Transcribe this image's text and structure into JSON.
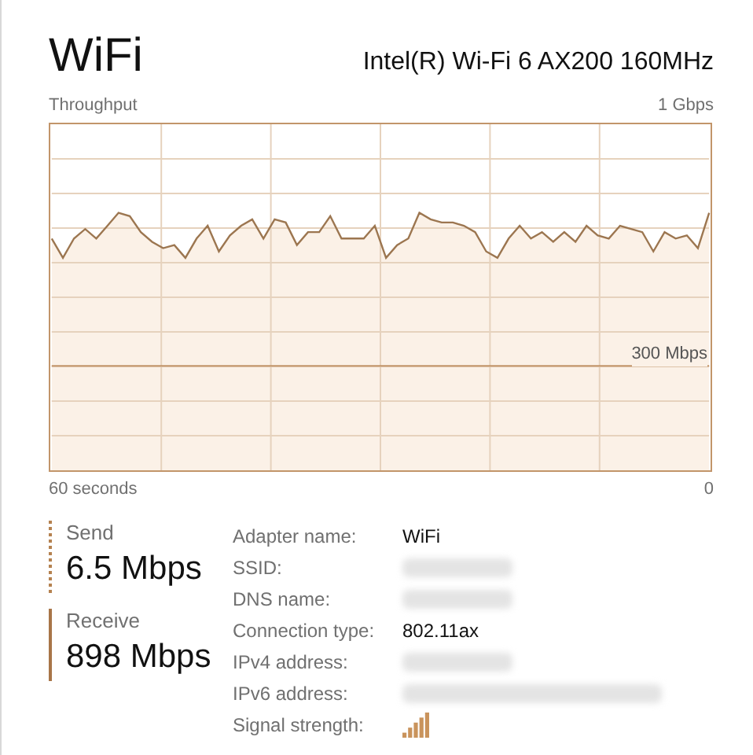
{
  "title": "WiFi",
  "adapter": "Intel(R) Wi-Fi 6 AX200 160MHz",
  "graph": {
    "label": "Throughput",
    "max_label": "1 Gbps",
    "mid_label": "300 Mbps",
    "time_label": "60 seconds",
    "zero_label": "0"
  },
  "stats": [
    {
      "label": "Send",
      "value": "6.5 Mbps",
      "kind": "send"
    },
    {
      "label": "Receive",
      "value": "898 Mbps",
      "kind": "receive"
    }
  ],
  "details": [
    {
      "label": "Adapter name:",
      "kind": "text",
      "value": "WiFi"
    },
    {
      "label": "SSID:",
      "kind": "redacted"
    },
    {
      "label": "DNS name:",
      "kind": "redacted"
    },
    {
      "label": "Connection type:",
      "kind": "text",
      "value": "802.11ax"
    },
    {
      "label": "IPv4 address:",
      "kind": "redacted"
    },
    {
      "label": "IPv6 address:",
      "kind": "redacted"
    },
    {
      "label": "Signal strength:",
      "kind": "signal"
    }
  ]
}
